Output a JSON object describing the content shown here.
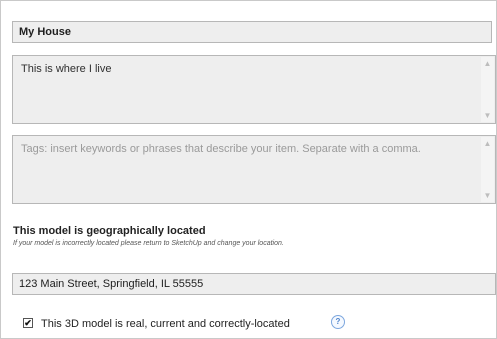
{
  "form": {
    "title_value": "My House",
    "description_value": "This is where I live",
    "tags_placeholder": "Tags: insert keywords or phrases that describe your item. Separate with a comma.",
    "geo_heading": "This model is geographically located",
    "geo_note": "If your model is incorrectly located please return to SketchUp and change your location.",
    "address_value": "123 Main Street, Springfield, IL 55555",
    "real_model_checkbox": {
      "checked": true,
      "mark": "✔",
      "label": "This 3D model is real, current and correctly-located"
    },
    "help_icon": {
      "icon": "help-icon",
      "glyph": "?"
    },
    "scroll_up_glyph": "▲",
    "scroll_down_glyph": "▼"
  },
  "colors": {
    "field_background": "#eeeeee",
    "field_border": "#b7b7b7",
    "help_blue": "#4f84cb"
  }
}
